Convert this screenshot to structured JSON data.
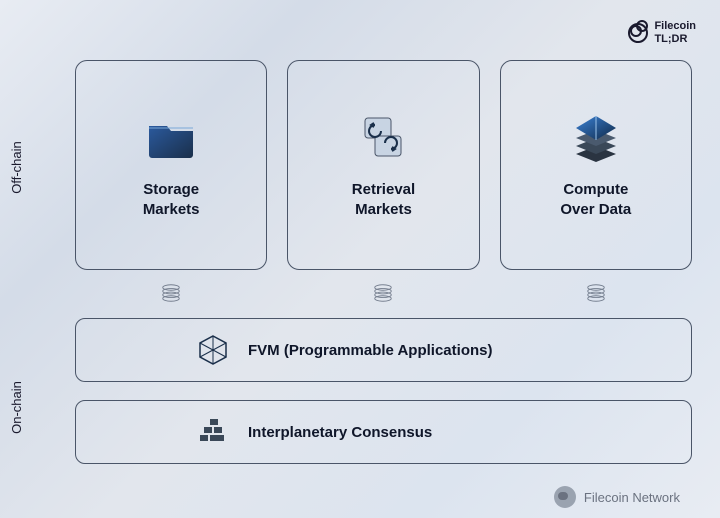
{
  "brand": {
    "line1": "Filecoin",
    "line2": "TL;DR"
  },
  "sections": {
    "off_chain": "Off-chain",
    "on_chain": "On-chain"
  },
  "cards": [
    {
      "label": "Storage\nMarkets",
      "icon": "folder-icon"
    },
    {
      "label": "Retrieval\nMarkets",
      "icon": "swap-icon"
    },
    {
      "label": "Compute\nOver Data",
      "icon": "layers-icon"
    }
  ],
  "wide": [
    {
      "label": "FVM (Programmable Applications)",
      "icon": "hexagon-icon"
    },
    {
      "label": "Interplanetary Consensus",
      "icon": "blocks-icon"
    }
  ],
  "footer": {
    "network": "Filecoin Network"
  }
}
